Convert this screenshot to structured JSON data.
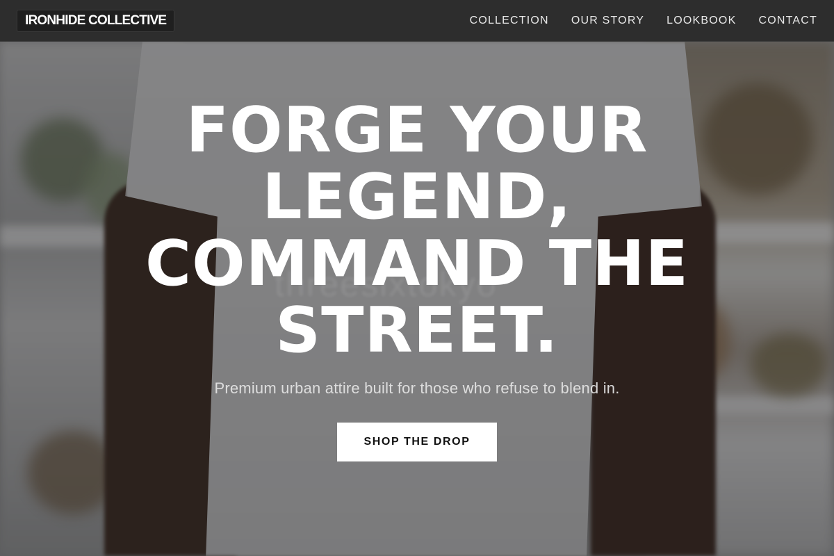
{
  "header": {
    "brand": "IRONHIDE COLLECTIVE",
    "nav": [
      {
        "label": "COLLECTION"
      },
      {
        "label": "OUR STORY"
      },
      {
        "label": "LOOKBOOK"
      },
      {
        "label": "CONTACT"
      }
    ]
  },
  "hero": {
    "headline": "FORGE YOUR LEGEND, COMMAND THE STREET.",
    "subtext": "Premium urban attire built for those who refuse to blend in.",
    "cta_label": "SHOP THE DROP",
    "shirt_print": "threesixtokyo"
  },
  "colors": {
    "navbar_bg": "#2d2d2d",
    "brand_bg": "#1f1f1f",
    "text": "#ffffff",
    "cta_bg": "#ffffff",
    "cta_text": "#111111"
  }
}
